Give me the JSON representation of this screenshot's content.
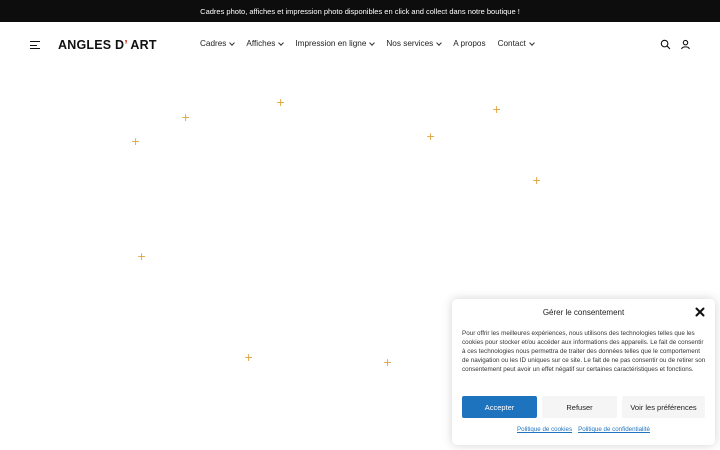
{
  "announcement": {
    "text": "Cadres photo, affiches et impression photo disponibles en click and collect dans notre boutique !"
  },
  "header": {
    "logo_main": "ANGLES D",
    "logo_apos": "’",
    "logo_end": " ART",
    "nav": [
      {
        "label": "Cadres",
        "dropdown": true
      },
      {
        "label": "Affiches",
        "dropdown": true
      },
      {
        "label": "Impression en ligne",
        "dropdown": true
      },
      {
        "label": "Nos services",
        "dropdown": true
      },
      {
        "label": "A propos",
        "dropdown": false
      },
      {
        "label": "Contact",
        "dropdown": true
      }
    ],
    "icons": [
      "menu-icon",
      "search-icon",
      "user-icon"
    ]
  },
  "hero": {
    "sparkle_glyph": "+",
    "sparkle_color": "#e2a23b"
  },
  "consent": {
    "title": "Gérer le consentement",
    "body": "Pour offrir les meilleures expériences, nous utilisons des technologies telles que les cookies pour stocker et/ou accéder aux informations des appareils. Le fait de consentir à ces technologies nous permettra de traiter des données telles que le comportement de navigation ou les ID uniques sur ce site. Le fait de ne pas consentir ou de retirer son consentement peut avoir un effet négatif sur certaines caractéristiques et fonctions.",
    "accept_label": "Accepter",
    "refuse_label": "Refuser",
    "prefs_label": "Voir les préférences",
    "cookie_policy_label": "Politique de cookies",
    "privacy_policy_label": "Politique de confidentialité",
    "accent_color": "#1e73be"
  }
}
